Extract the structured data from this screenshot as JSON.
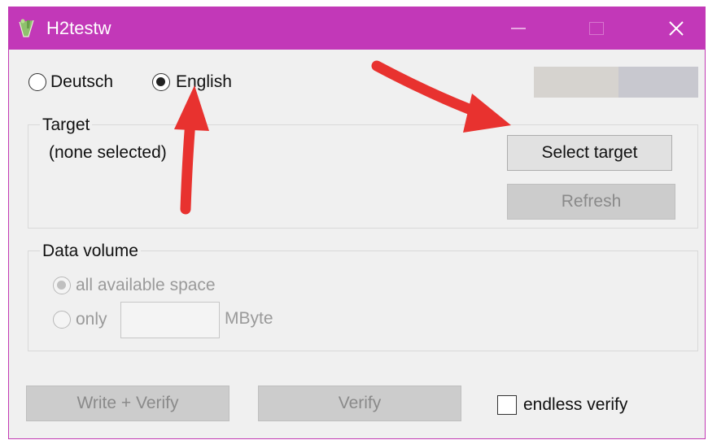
{
  "window": {
    "title": "H2testw",
    "accent_color": "#c238b8",
    "controls": {
      "minimize": "minimize-icon",
      "maximize": "maximize-icon",
      "close_glyph": "✕"
    }
  },
  "language": {
    "options": [
      {
        "label": "Deutsch",
        "selected": false
      },
      {
        "label": "English",
        "selected": true
      }
    ]
  },
  "target": {
    "group_title": "Target",
    "value": "(none selected)",
    "select_button": "Select target",
    "refresh_button": "Refresh"
  },
  "data_volume": {
    "group_title": "Data volume",
    "all_label": "all available space",
    "only_label": "only",
    "only_value": "",
    "unit": "MByte"
  },
  "actions": {
    "write_verify": "Write + Verify",
    "verify": "Verify",
    "endless_verify": "endless verify",
    "endless_checked": false
  },
  "annotations": {
    "arrow_color": "#e8322f"
  }
}
